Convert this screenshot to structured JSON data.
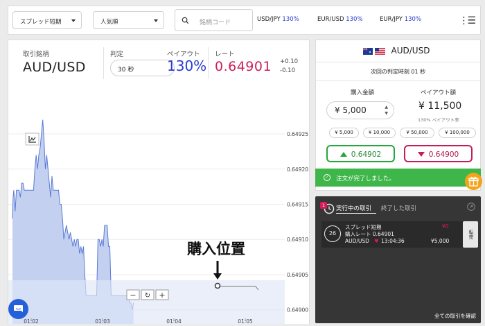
{
  "topbar": {
    "filter1": "スプレッド短期",
    "filter2": "人気順",
    "search_placeholder": "銘柄コード",
    "tickers": [
      {
        "pair": "USD/JPY",
        "pct": "130%"
      },
      {
        "pair": "EUR/USD",
        "pct": "130%"
      },
      {
        "pair": "EUR/JPY",
        "pct": "130%"
      }
    ]
  },
  "chart_panel": {
    "label_symbol": "取引銘柄",
    "symbol": "AUD/USD",
    "label_judge": "判定",
    "judge_value": "30 秒",
    "label_payout": "ペイアウト",
    "payout": "130%",
    "label_rate": "レート",
    "rate": "0.64901",
    "change_up": "+0.10",
    "change_down": "-0.10",
    "annotation": "購入位置",
    "zoom_minus": "−",
    "zoom_reset": "↻",
    "zoom_plus": "+"
  },
  "chart_data": {
    "type": "area",
    "yticks": [
      "0.64925",
      "0.64920",
      "0.64915",
      "0.64910",
      "0.64905",
      "0.64900"
    ],
    "xticks": [
      "01:02",
      "01:03",
      "01:04",
      "01:05"
    ],
    "ylim": [
      0.64898,
      0.64932
    ],
    "x": [
      0,
      0.5,
      1,
      2,
      3,
      4,
      5,
      6,
      7,
      8,
      9,
      10,
      11,
      12,
      13,
      14,
      15,
      16,
      17,
      18,
      19,
      20,
      21,
      22,
      23,
      24,
      25,
      26,
      27,
      28,
      29,
      30,
      31,
      32,
      33,
      34,
      35,
      36,
      37,
      38,
      39,
      40,
      41,
      42,
      43,
      44,
      45,
      46,
      47,
      48,
      49,
      50,
      51,
      52,
      53,
      54,
      55,
      56,
      57,
      58,
      59,
      60,
      61,
      62,
      63,
      64,
      65,
      66,
      67,
      68,
      69,
      70,
      71,
      72,
      73,
      74,
      75,
      76,
      77,
      78,
      79,
      80,
      81,
      82,
      83,
      84,
      85,
      86,
      87,
      88,
      89,
      90,
      91,
      92,
      93,
      94,
      95,
      96,
      97,
      98,
      99,
      100,
      101,
      102,
      103,
      104,
      105,
      106,
      107,
      108,
      109,
      110,
      111,
      112,
      113,
      114,
      115,
      116,
      117,
      118,
      119,
      120,
      121,
      122,
      123,
      124,
      125,
      126,
      127,
      128,
      129,
      130,
      131,
      132,
      133,
      134,
      135,
      136,
      137,
      138,
      139,
      140,
      141,
      142,
      143,
      144,
      145,
      146,
      147,
      148,
      149,
      150,
      151,
      152,
      153,
      154,
      155,
      156,
      157,
      158
    ],
    "series": [
      {
        "values": [
          0.64913,
          0.64916,
          0.64917,
          0.64914,
          0.64917,
          0.64917,
          0.64917,
          0.64916,
          0.64918,
          0.64918,
          0.64917,
          0.64917,
          0.64917,
          0.64917,
          0.64917,
          0.64917,
          0.64917,
          0.64917,
          0.6492,
          0.64922,
          0.6492,
          0.64922,
          0.64923,
          0.64925,
          0.64927,
          0.64924,
          0.6492,
          0.64922,
          0.6492,
          0.64918,
          0.64916,
          0.64919,
          0.64917,
          0.64917,
          0.64917,
          0.64917,
          0.64917,
          0.64915,
          0.64915,
          0.64913,
          0.6491,
          0.64911,
          0.64912,
          0.64911,
          0.6491,
          0.64911,
          0.6491,
          0.64909,
          0.6491,
          0.64909,
          0.6491,
          0.6491,
          0.64908,
          0.64909,
          0.64908,
          0.64909,
          0.64905,
          0.64902,
          0.64902,
          0.64902,
          0.64902,
          0.64902,
          0.64902,
          0.64902,
          0.64902,
          0.64902,
          0.6491,
          0.6491,
          0.64909,
          0.6491,
          0.64909,
          0.64912,
          0.64912,
          0.64912,
          0.64909,
          0.64909,
          0.64902,
          0.64902,
          0.64902,
          0.64902,
          0.64902,
          0.64902,
          0.64902,
          0.64902,
          0.64902,
          0.64902,
          0.64902,
          0.64902,
          0.64902,
          0.64902,
          0.64901,
          0.64901,
          0.649,
          0.64901
        ]
      }
    ]
  },
  "trade_panel": {
    "pair": "AUD/USD",
    "next_judge": "次回の判定時刻 01 秒",
    "label_amount": "購入金額",
    "label_payout": "ペイアウト額",
    "amount": "¥ 5,000",
    "payout_amount": "¥ 11,500",
    "payout_rate_label": "130% ペイアウト率",
    "chips": [
      "¥ 5,000",
      "¥ 10,000",
      "¥ 50,000",
      "¥ 100,000"
    ],
    "buy_high": "0.64902",
    "buy_low": "0.64900",
    "toast": "注文が完了しました。"
  },
  "trades": {
    "badge": "1",
    "tab_active": "実行中の取引",
    "tab_done": "終了した取引",
    "item": {
      "countdown": "26",
      "type": "スプレッド短期",
      "rate_label": "購入レート 0.64901",
      "pair": "AUD/USD",
      "time": "13:04:36",
      "profit": "¥0",
      "amount": "¥5,000",
      "sell_label": "転売"
    },
    "view_all": "全ての取引を確認"
  },
  "colors": {
    "accent_blue": "#2a3ccf",
    "rate_red": "#cc1f5a",
    "high_green": "#23a83a",
    "low_red": "#c41e5a",
    "toast_green": "#3fb649",
    "area_fill": "#c4d0ef",
    "line_blue": "#5a7ad6"
  }
}
